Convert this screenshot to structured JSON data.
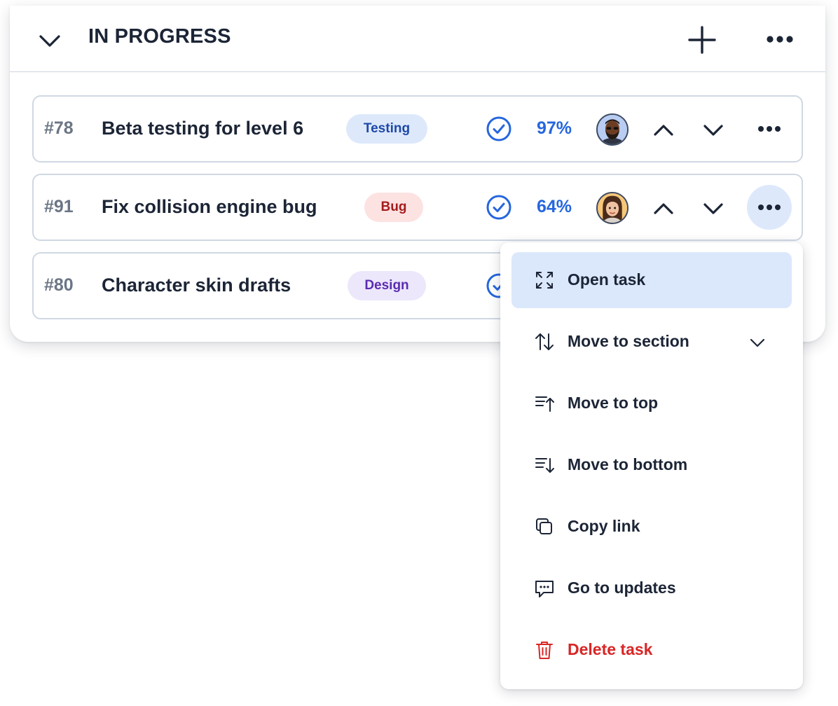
{
  "section": {
    "title": "IN PROGRESS",
    "icons": {
      "collapse": "chevron-down-icon",
      "add": "plus-icon",
      "more": "more-horizontal-icon"
    }
  },
  "tasks": [
    {
      "id": "#78",
      "title": "Beta testing for level 6",
      "tag": "Testing",
      "tag_color": "#1f49a8",
      "tag_bg": "#dde9fb",
      "progress": "97%",
      "avatar": "avatar-man-beard"
    },
    {
      "id": "#91",
      "title": "Fix collision engine bug",
      "tag": "Bug",
      "tag_color": "#a51c1c",
      "tag_bg": "#fde2e2",
      "progress": "64%",
      "avatar": "avatar-woman-brown-hair"
    },
    {
      "id": "#80",
      "title": "Character skin drafts",
      "tag": "Design",
      "tag_color": "#5b2bb0",
      "tag_bg": "#ece7fb"
    }
  ],
  "context_menu": {
    "items": [
      {
        "label": "Open task",
        "icon": "expand-icon",
        "active": true
      },
      {
        "label": "Move to section",
        "icon": "arrows-up-down-icon",
        "has_submenu": true
      },
      {
        "label": "Move to top",
        "icon": "sort-to-top-icon"
      },
      {
        "label": "Move to bottom",
        "icon": "sort-to-bottom-icon"
      },
      {
        "label": "Copy link",
        "icon": "copy-icon"
      },
      {
        "label": "Go to updates",
        "icon": "comment-icon"
      },
      {
        "label": "Delete task",
        "icon": "trash-icon",
        "danger": true
      }
    ]
  },
  "colors": {
    "text": "#1c2536",
    "accent": "#2566de",
    "danger": "#d92626",
    "highlight": "#dbe8fc"
  }
}
